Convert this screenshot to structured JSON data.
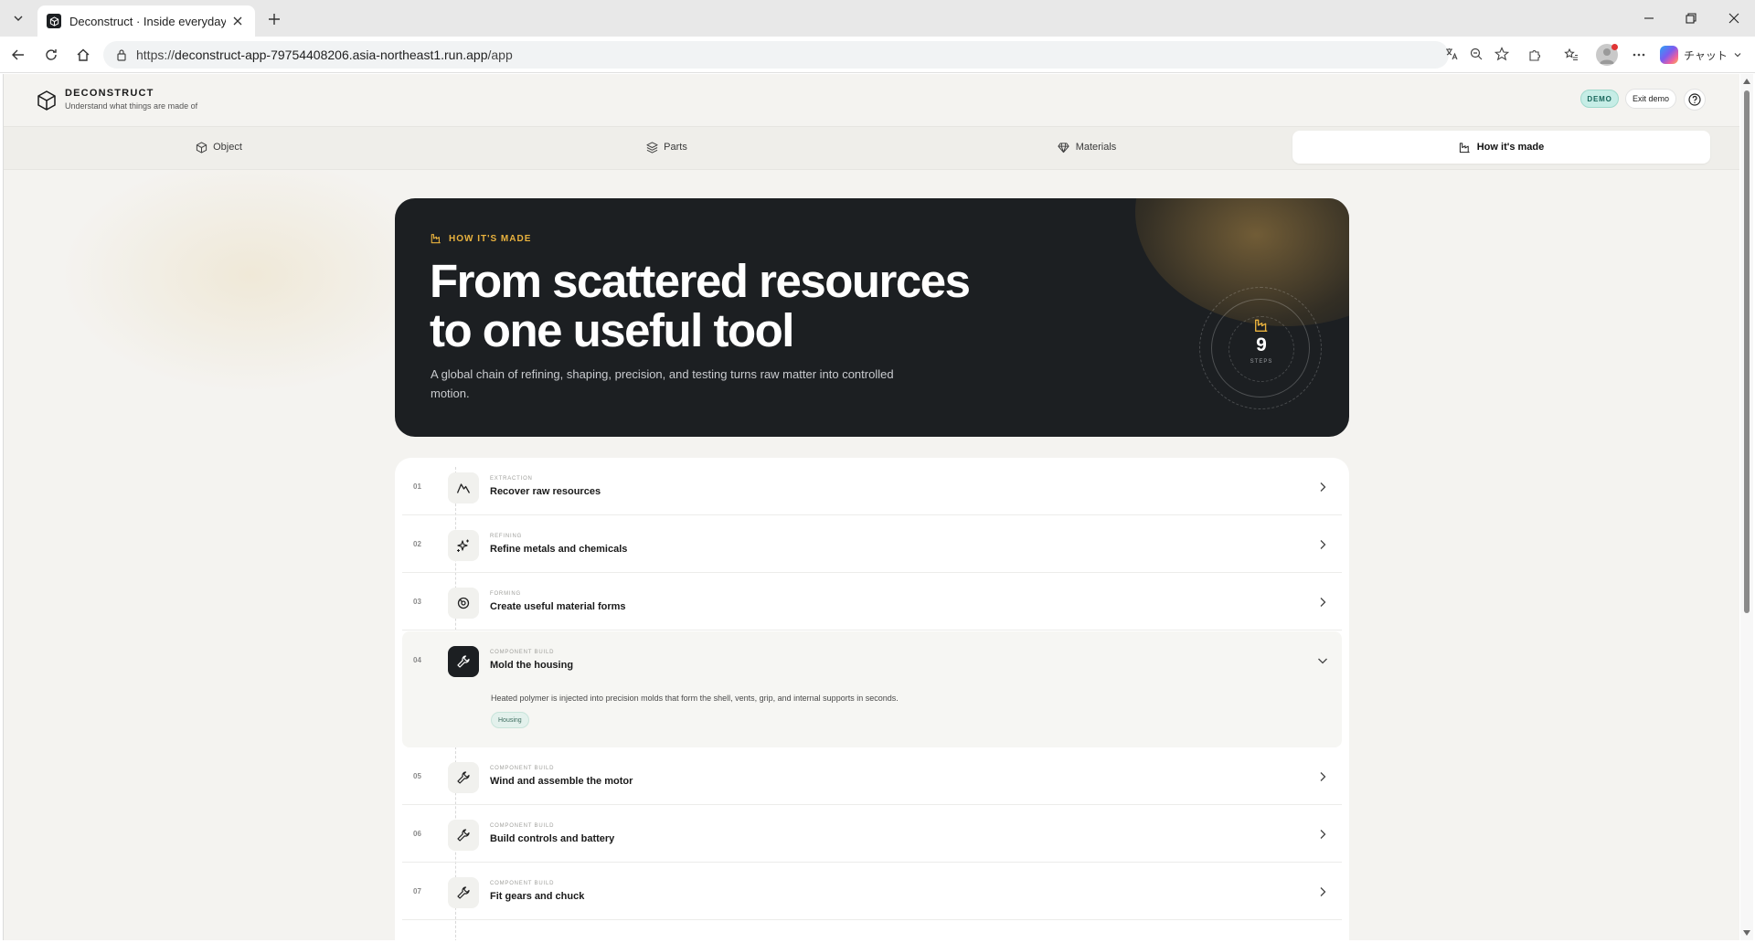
{
  "browser": {
    "tab_title": "Deconstruct · Inside everyday things",
    "url_prefix": "https://",
    "url_host": "deconstruct-app-79754408206.asia-northeast1.run.app",
    "url_path": "/app",
    "copilot_label": "チャット"
  },
  "app": {
    "brand_name": "DECONSTRUCT",
    "tagline": "Understand what things are made of",
    "demo_badge": "DEMO",
    "exit_demo": "Exit demo"
  },
  "tabs": [
    {
      "label": "Object",
      "icon": "cube-icon",
      "active": false
    },
    {
      "label": "Parts",
      "icon": "layers-icon",
      "active": false
    },
    {
      "label": "Materials",
      "icon": "gem-icon",
      "active": false
    },
    {
      "label": "How it's made",
      "icon": "factory-icon",
      "active": true
    }
  ],
  "hero": {
    "eyebrow": "HOW IT'S MADE",
    "title_line1": "From scattered resources",
    "title_line2": "to one useful tool",
    "subtitle": "A global chain of refining, shaping, precision, and testing turns raw matter into controlled motion.",
    "steps_count": "9",
    "steps_label": "STEPS",
    "accent_color": "#e9b23e"
  },
  "steps": [
    {
      "num": "01",
      "category": "EXTRACTION",
      "title": "Recover raw resources",
      "icon": "mountain-icon",
      "expanded": false
    },
    {
      "num": "02",
      "category": "REFINING",
      "title": "Refine metals and chemicals",
      "icon": "sparkle-icon",
      "expanded": false
    },
    {
      "num": "03",
      "category": "FORMING",
      "title": "Create useful material forms",
      "icon": "forming-icon",
      "expanded": false
    },
    {
      "num": "04",
      "category": "COMPONENT BUILD",
      "title": "Mold the housing",
      "icon": "wrench-icon",
      "expanded": true,
      "description": "Heated polymer is injected into precision molds that form the shell, vents, grip, and internal supports in seconds.",
      "tag": "Housing"
    },
    {
      "num": "05",
      "category": "COMPONENT BUILD",
      "title": "Wind and assemble the motor",
      "icon": "wrench-icon",
      "expanded": false
    },
    {
      "num": "06",
      "category": "COMPONENT BUILD",
      "title": "Build controls and battery",
      "icon": "wrench-icon",
      "expanded": false
    },
    {
      "num": "07",
      "category": "COMPONENT BUILD",
      "title": "Fit gears and chuck",
      "icon": "wrench-icon",
      "expanded": false
    }
  ]
}
